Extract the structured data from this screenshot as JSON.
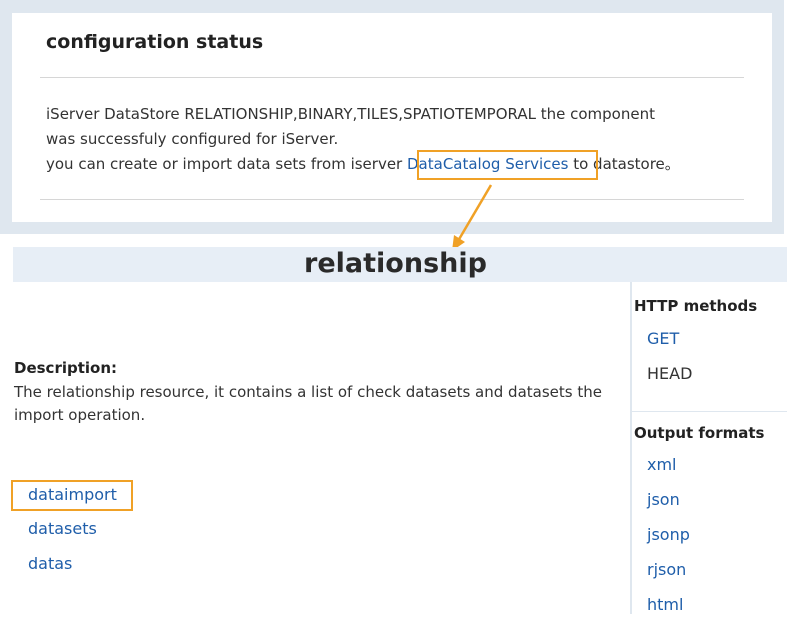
{
  "config": {
    "title": "configuration status",
    "line1": "iServer DataStore  RELATIONSHIP,BINARY,TILES,SPATIOTEMPORAL the component",
    "line2": "was successfuly configured for iServer.",
    "line3_pre": "you can create or import data sets from iserver ",
    "line3_link": "DataCatalog Services",
    "line3_post": " to datastore。"
  },
  "resource": {
    "title": "relationship",
    "description_label": "Description:",
    "description_text": "The relationship resource, it contains a list of check datasets and datasets the import operation.",
    "children": [
      "dataimport",
      "datasets",
      "datas"
    ]
  },
  "sidebar": {
    "http_methods_label": "HTTP methods",
    "http_methods": [
      "GET",
      "HEAD"
    ],
    "output_formats_label": "Output formats",
    "output_formats": [
      "xml",
      "json",
      "jsonp",
      "rjson",
      "html"
    ]
  },
  "colors": {
    "highlight": "#f0a126",
    "link": "#1f5eaa",
    "panel_bg": "#dfe7ef"
  }
}
